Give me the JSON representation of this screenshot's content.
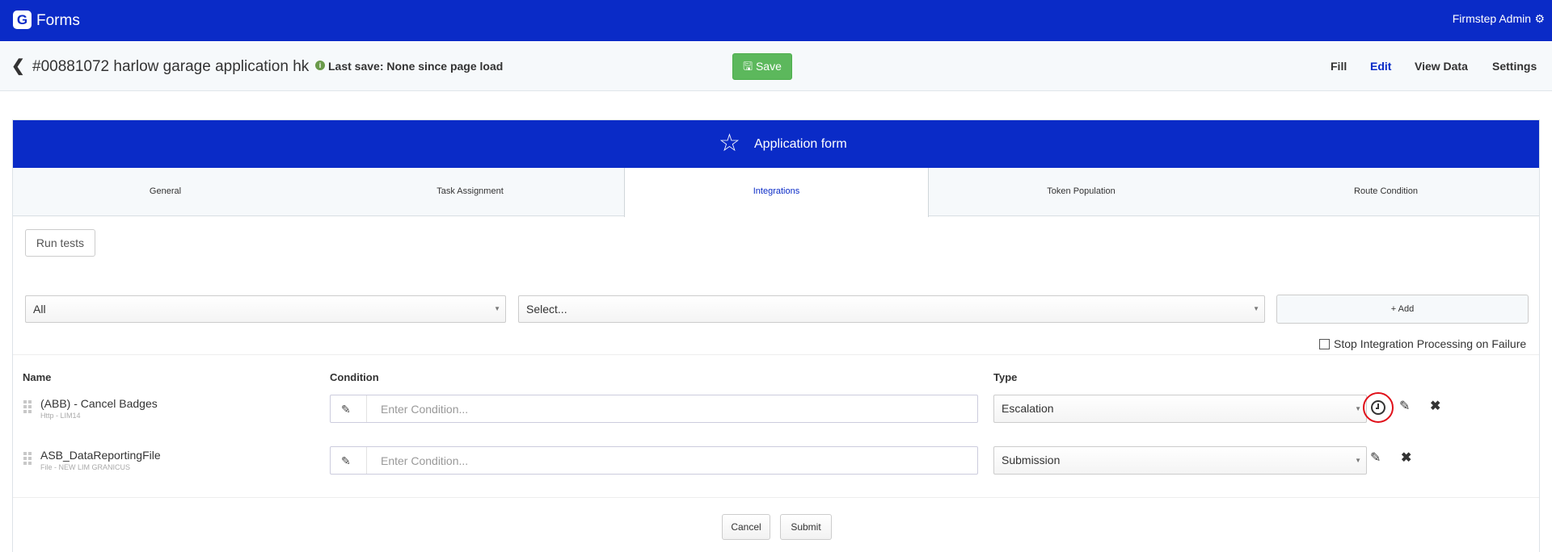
{
  "topbar": {
    "logo_letter": "G",
    "app_name": "Forms",
    "user_name": "Firmstep Admin",
    "user_icon": "gear-icon"
  },
  "subheader": {
    "back_icon": "chevron-left-icon",
    "form_title": "#00881072 harlow garage application hk",
    "info_icon": "info-icon",
    "last_save": "Last save: None since page load",
    "save_icon": "floppy-icon",
    "save_label": "Save",
    "nav": [
      {
        "label": "Fill",
        "active": false
      },
      {
        "label": "Edit",
        "active": true
      },
      {
        "label": "View Data",
        "active": false
      },
      {
        "label": "Settings",
        "active": false
      }
    ]
  },
  "card": {
    "title_icon": "star-icon",
    "title": "Application form",
    "tabs": [
      {
        "label": "General",
        "active": false
      },
      {
        "label": "Task Assignment",
        "active": false
      },
      {
        "label": "Integrations",
        "active": true
      },
      {
        "label": "Token Population",
        "active": false
      },
      {
        "label": "Route Condition",
        "active": false
      }
    ]
  },
  "integrations": {
    "run_tests_label": "Run tests",
    "filter_select": "All",
    "integration_select": "Select...",
    "add_label": "+ Add",
    "stop_label": "Stop Integration Processing on Failure",
    "stop_checked": false,
    "columns": {
      "name": "Name",
      "condition": "Condition",
      "type": "Type"
    },
    "rows": [
      {
        "name": "(ABB) - Cancel Badges",
        "sub": "Http - LIM14",
        "condition_placeholder": "Enter Condition...",
        "type": "Escalation",
        "has_schedule": true
      },
      {
        "name": "ASB_DataReportingFile",
        "sub": "File - NEW LIM GRANICUS",
        "condition_placeholder": "Enter Condition...",
        "type": "Submission",
        "has_schedule": false
      }
    ],
    "cancel_label": "Cancel",
    "submit_label": "Submit"
  }
}
